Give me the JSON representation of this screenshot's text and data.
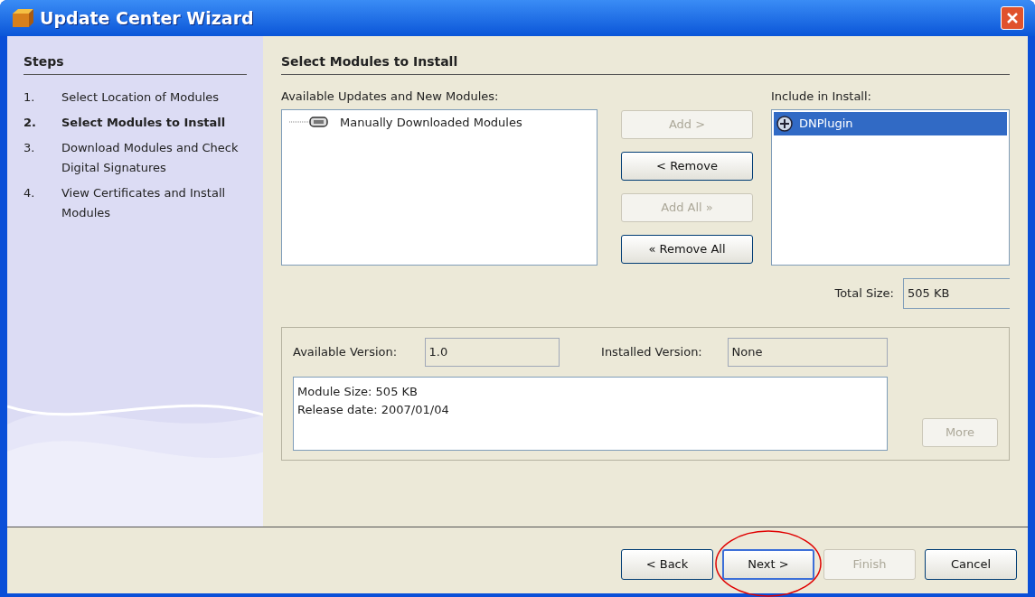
{
  "window": {
    "title": "Update Center Wizard"
  },
  "steps": {
    "title": "Steps",
    "items": [
      {
        "number": "1.",
        "label": "Select Location of Modules",
        "selected": false
      },
      {
        "number": "2.",
        "label": "Select Modules to Install",
        "selected": true
      },
      {
        "number": "3.",
        "label": "Download Modules and Check Digital Signatures",
        "selected": false
      },
      {
        "number": "4.",
        "label": "View Certificates and Install Modules",
        "selected": false
      }
    ]
  },
  "panel_title": "Select Modules to Install",
  "available": {
    "label": "Available Updates and New Modules:",
    "items": [
      {
        "label": "Manually Downloaded Modules",
        "selected": false
      }
    ]
  },
  "transfer_buttons": [
    {
      "label": "Add >",
      "disabled": true
    },
    {
      "label": "< Remove",
      "disabled": false
    },
    {
      "label": "Add All »",
      "disabled": true
    },
    {
      "label": "« Remove All",
      "disabled": false
    }
  ],
  "include": {
    "label": "Include in Install:",
    "items": [
      {
        "label": "DNPlugin",
        "selected": true
      }
    ]
  },
  "total_size": {
    "label": "Total Size:",
    "value": "505 KB"
  },
  "details": {
    "available_version": {
      "label": "Available Version:",
      "value": "1.0"
    },
    "installed_version": {
      "label": "Installed Version:",
      "value": "None"
    },
    "description": [
      "Module Size: 505 KB",
      "Release date: 2007/01/04"
    ],
    "more_button": {
      "label": "More",
      "disabled": true
    }
  },
  "nav_buttons": [
    {
      "label": "< Back",
      "disabled": false,
      "highlighted": false
    },
    {
      "label": "Next >",
      "disabled": false,
      "highlighted": true
    },
    {
      "label": "Finish",
      "disabled": true,
      "highlighted": false
    },
    {
      "label": "Cancel",
      "disabled": false,
      "highlighted": false
    }
  ]
}
